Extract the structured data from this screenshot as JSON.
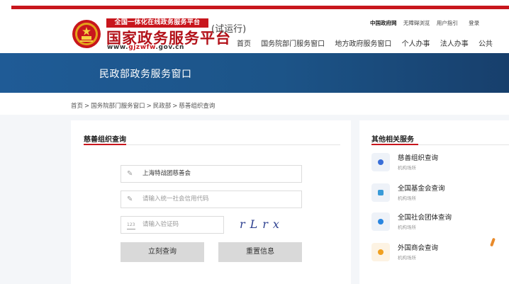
{
  "header": {
    "slogan": "全国一体化在线政务服务平台",
    "platform_name": "国家政务服务平台",
    "url_prefix": "www.",
    "url_brand": "gjzwfw",
    "url_suffix": ".gov.cn",
    "trial": "(试运行)",
    "top_links": {
      "gov_site": "中国政府网",
      "accessibility": "无障碍浏览",
      "guide": "用户指引",
      "login": "登录"
    },
    "nav": [
      "首页",
      "国务院部门服务窗口",
      "地方政府服务窗口",
      "个人办事",
      "法人办事",
      "公共"
    ]
  },
  "banner": {
    "title": "民政部政务服务窗口"
  },
  "breadcrumb": [
    "首页",
    "国务院部门服务窗口",
    "民政部",
    "慈善组织查询"
  ],
  "breadcrumb_sep": ">",
  "query": {
    "title": "慈善组织查询",
    "org_name_value": "上海特战团慈善会",
    "credit_code_placeholder": "请输入统一社会信用代码",
    "captcha_placeholder": "请输入验证码",
    "captcha_icon_text": "123",
    "captcha_text": "rLrx",
    "submit_label": "立刻查询",
    "reset_label": "重置信息"
  },
  "related": {
    "title": "其他相关服务",
    "items": [
      {
        "name": "慈善组织查询",
        "sub": "机构场所",
        "icon": "person-icon",
        "color": "#3a6fd8"
      },
      {
        "name": "全国基金会查询",
        "sub": "机构场所",
        "icon": "document-icon",
        "color": "#3a9bd8"
      },
      {
        "name": "全国社会团体查询",
        "sub": "机构场所",
        "icon": "group-icon",
        "color": "#2a86e0"
      },
      {
        "name": "外国商会查询",
        "sub": "机构场所",
        "icon": "clock-icon",
        "color": "#f0a020"
      }
    ]
  },
  "colors": {
    "brand_red": "#c8161d",
    "banner_blue": "#1f5b96"
  }
}
